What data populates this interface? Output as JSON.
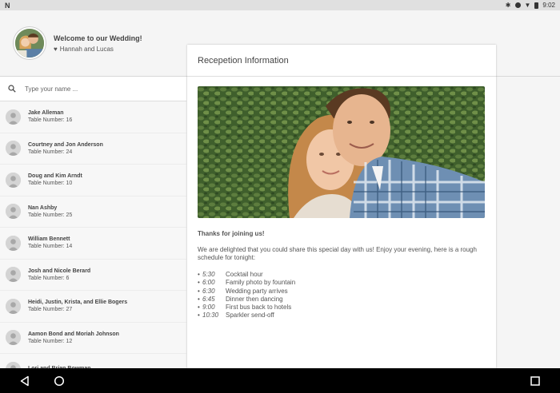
{
  "status_bar": {
    "app_glyph": "N",
    "time": "9:02",
    "icons": [
      "bluetooth-icon",
      "do-not-disturb-icon",
      "wifi-icon",
      "battery-icon"
    ]
  },
  "header": {
    "welcome": "Welcome to our Wedding!",
    "couple": "Hannah and Lucas"
  },
  "search": {
    "placeholder": "Type your name ..."
  },
  "guests": [
    {
      "name": "Jake Alleman",
      "table": "Table Number: 16"
    },
    {
      "name": "Courtney and Jon Anderson",
      "table": "Table Number: 24"
    },
    {
      "name": "Doug and Kim Arndt",
      "table": "Table Number: 10"
    },
    {
      "name": "Nan Ashby",
      "table": "Table Number: 25"
    },
    {
      "name": "William Bennett",
      "table": "Table Number: 14"
    },
    {
      "name": "Josh and Nicole Berard",
      "table": "Table Number: 6"
    },
    {
      "name": "Heidi, Justin, Krista, and Ellie Bogers",
      "table": "Table Number: 27"
    },
    {
      "name": "Aamon Bond and Moriah Johnson",
      "table": "Table Number: 12"
    },
    {
      "name": "Lori and Brian Bowman",
      "table": ""
    }
  ],
  "card": {
    "title": "Recepetion Information",
    "thanks": "Thanks for joining us!",
    "intro": "We are delighted that you could share this special day with us! Enjoy your evening, here is a rough schedule for tonight:",
    "schedule": [
      {
        "time": "5:30",
        "event": "Cocktail hour"
      },
      {
        "time": "6:00",
        "event": "Family photo by fountain"
      },
      {
        "time": "6:30",
        "event": "Wedding party arrives"
      },
      {
        "time": "6:45",
        "event": "Dinner then dancing"
      },
      {
        "time": "9:00",
        "event": "First bus back to hotels"
      },
      {
        "time": "10:30",
        "event": "Sparkler send-off"
      }
    ]
  },
  "nav": [
    "back-icon",
    "home-icon",
    "recents-icon"
  ],
  "colors": {
    "background": "#f5f5f5",
    "navbar": "#000000",
    "text": "#444444"
  }
}
